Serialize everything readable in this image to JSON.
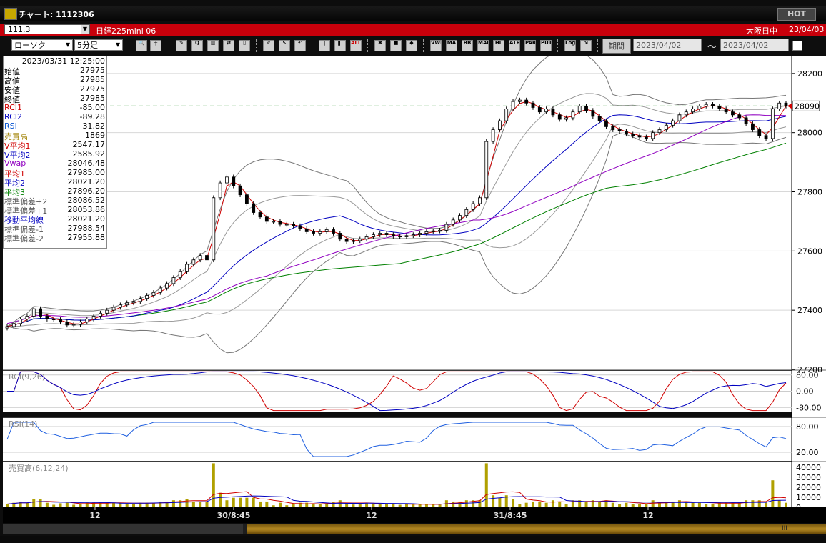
{
  "window": {
    "title": "チャート: 1112306",
    "hot_label": "HOT"
  },
  "infobar": {
    "symbol": "111.3",
    "instrument": "日経225mini 06",
    "market": "大阪日中",
    "date": "23/04/03"
  },
  "toolbar": {
    "chart_type": "ローソク",
    "interval": "5分足",
    "period_label": "期間",
    "date_from": "2023/04/02",
    "date_to": "2023/04/02",
    "buttons": [
      "VWP",
      "MA",
      "BB",
      "MAE",
      "HL",
      "ATR",
      "PAR",
      "PUT",
      "Log"
    ],
    "all_label": "ALL"
  },
  "info_panel": {
    "datetime": "2023/03/31  12:25:00",
    "rows": [
      {
        "label": "始値",
        "value": "27975",
        "color": "#000000"
      },
      {
        "label": "高値",
        "value": "27985",
        "color": "#000000"
      },
      {
        "label": "安値",
        "value": "27975",
        "color": "#000000"
      },
      {
        "label": "終値",
        "value": "27985",
        "color": "#000000"
      },
      {
        "label": "RCI1",
        "value": "-85.00",
        "color": "#d00000"
      },
      {
        "label": "RCI2",
        "value": "-89.28",
        "color": "#0000c0"
      },
      {
        "label": "RSI",
        "value": "31.82",
        "color": "#0050d0"
      },
      {
        "label": "売買高",
        "value": "1869",
        "color": "#a08000"
      },
      {
        "label": "V平均1",
        "value": "2547.17",
        "color": "#d00000"
      },
      {
        "label": "V平均2",
        "value": "2585.92",
        "color": "#0000c0"
      },
      {
        "label": "Vwap",
        "value": "28046.48",
        "color": "#9000c0"
      },
      {
        "label": "平均1",
        "value": "27985.00",
        "color": "#d00000"
      },
      {
        "label": "平均2",
        "value": "28021.20",
        "color": "#0000c0"
      },
      {
        "label": "平均3",
        "value": "27896.20",
        "color": "#008000"
      },
      {
        "label": "標準偏差+2",
        "value": "28086.52",
        "color": "#555555"
      },
      {
        "label": "標準偏差+1",
        "value": "28053.86",
        "color": "#555555"
      },
      {
        "label": "移動平均線",
        "value": "28021.20",
        "color": "#0000c0"
      },
      {
        "label": "標準偏差-1",
        "value": "27988.54",
        "color": "#555555"
      },
      {
        "label": "標準偏差-2",
        "value": "27955.88",
        "color": "#555555"
      }
    ]
  },
  "chart_data": [
    {
      "type": "candlestick",
      "ylim": [
        27200,
        28260
      ],
      "y_ticks": [
        "28200",
        "28000",
        "27800",
        "27600",
        "27400",
        "27200"
      ],
      "x_labels": [
        "12",
        "30/8:45",
        "12",
        "31/8:45",
        "12"
      ],
      "reference_line": 28090,
      "price_marker": "28090",
      "close": [
        27345,
        27355,
        27370,
        27380,
        27405,
        27380,
        27370,
        27368,
        27360,
        27350,
        27352,
        27360,
        27370,
        27380,
        27390,
        27400,
        27410,
        27418,
        27425,
        27430,
        27440,
        27450,
        27460,
        27475,
        27490,
        27510,
        27530,
        27555,
        27570,
        27585,
        27570,
        27780,
        27830,
        27850,
        27820,
        27790,
        27760,
        27730,
        27715,
        27700,
        27700,
        27690,
        27690,
        27685,
        27675,
        27665,
        27660,
        27665,
        27672,
        27660,
        27640,
        27632,
        27635,
        27640,
        27648,
        27655,
        27660,
        27655,
        27650,
        27648,
        27652,
        27655,
        27660,
        27665,
        27668,
        27670,
        27690,
        27705,
        27720,
        27740,
        27760,
        27780,
        27970,
        28010,
        28040,
        28080,
        28105,
        28110,
        28100,
        28085,
        28070,
        28080,
        28060,
        28045,
        28050,
        28070,
        28090,
        28075,
        28055,
        28040,
        28020,
        28010,
        28005,
        27995,
        27990,
        27985,
        27980,
        28000,
        28010,
        28025,
        28040,
        28060,
        28070,
        28080,
        28090,
        28095,
        28090,
        28080,
        28070,
        28060,
        28050,
        28030,
        28010,
        27990,
        27980,
        28080,
        28100,
        28090
      ],
      "rci1": {
        "name": "RCI1",
        "range": [
          -100,
          100
        ],
        "y_ticks": [
          "80.00",
          "0.00",
          "-80.00"
        ]
      },
      "rci2": {
        "name": "RCI2"
      },
      "rsi": {
        "name": "RSI(14)",
        "y_ticks": [
          "80.00",
          "20.00"
        ]
      },
      "volume": {
        "name": "売買高(6,12,24)",
        "y_ticks": [
          "40000",
          "30000",
          "20000",
          "10000",
          "0"
        ]
      },
      "rci_panel_label": "RCI(9,26)",
      "rsi_panel_label": "RSI(14)",
      "vol_panel_label": "売買高(6,12,24)"
    }
  ]
}
